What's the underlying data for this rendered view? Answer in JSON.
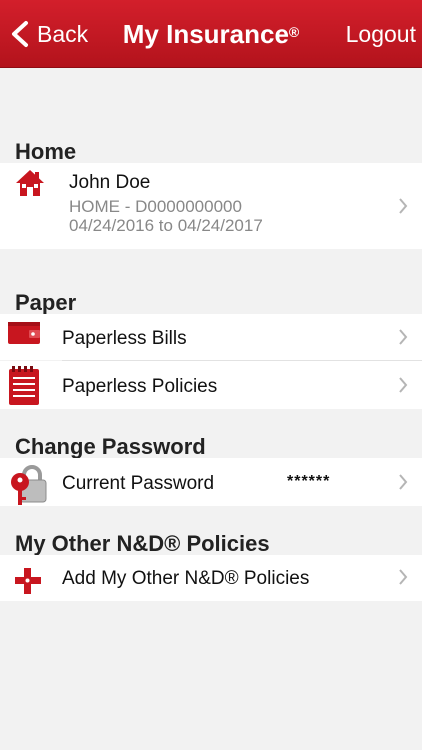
{
  "header": {
    "back_label": "Back",
    "title": "My Insurance",
    "title_mark": "®",
    "logout_label": "Logout"
  },
  "sections": {
    "home": {
      "title": "Home",
      "name": "John Doe",
      "policy": "HOME - D0000000000",
      "dates": "04/24/2016 to 04/24/2017"
    },
    "paper": {
      "title": "Paper",
      "items": [
        {
          "label": "Paperless Bills"
        },
        {
          "label": "Paperless Policies"
        }
      ]
    },
    "password": {
      "title": "Change Password",
      "label": "Current Password",
      "value": "******"
    },
    "other": {
      "title": "My Other N&D® Policies",
      "label": "Add My Other N&D® Policies"
    }
  },
  "colors": {
    "brand": "#c8161f",
    "background": "#f2f2f2"
  }
}
